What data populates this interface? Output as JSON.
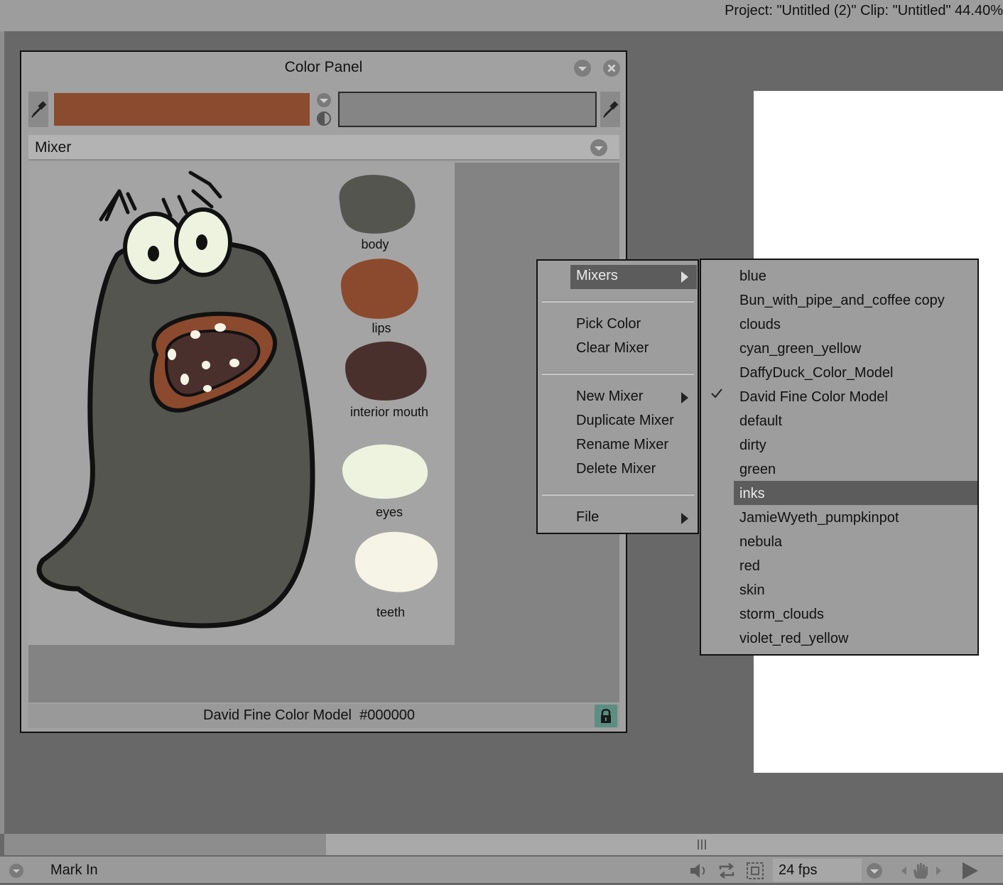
{
  "header": {
    "project_info": "Project:  \"Untitled (2)\"  Clip: \"Untitled\"   44.40%"
  },
  "color_panel": {
    "title": "Color Panel",
    "primary_color": "#8a4b2f",
    "secondary_color": "#858585",
    "mixer_title": "Mixer",
    "status": "David Fine Color Model  #000000",
    "swatches": [
      {
        "label": "body",
        "color": "#555550"
      },
      {
        "label": "lips",
        "color": "#8b4a2d"
      },
      {
        "label": "interior mouth",
        "color": "#4a302c"
      },
      {
        "label": "eyes",
        "color": "#eef3df"
      },
      {
        "label": "teeth",
        "color": "#f6f4e6"
      }
    ]
  },
  "context_menu": {
    "items": [
      "Mixers",
      "Pick Color",
      "Clear Mixer",
      "New Mixer",
      "Duplicate Mixer",
      "Rename Mixer",
      "Delete Mixer",
      "File"
    ]
  },
  "submenu": {
    "items": [
      "blue",
      "Bun_with_pipe_and_coffee copy",
      "clouds",
      "cyan_green_yellow",
      "DaffyDuck_Color_Model",
      "David Fine Color Model",
      "default",
      "dirty",
      "green",
      "inks",
      "JamieWyeth_pumpkinpot",
      "nebula",
      "red",
      "skin",
      "storm_clouds",
      "violet_red_yellow"
    ],
    "checked": "David Fine Color Model",
    "highlighted": "inks"
  },
  "bottom": {
    "mark_in": "Mark In",
    "fps": "24 fps"
  }
}
